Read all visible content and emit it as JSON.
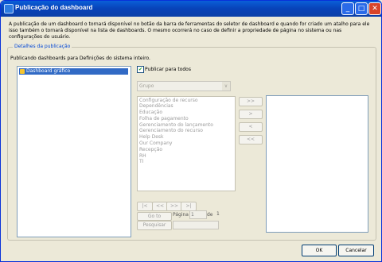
{
  "window": {
    "title": "Publicação do dashboard",
    "controls": {
      "minimize": "_",
      "maximize": "□",
      "close": "✕"
    }
  },
  "intro_text": "A publicação de um dashboard o tornará disponível no botão da barra de ferramentas do seletor de dashboard e quando for criado um atalho para ele isso também o tornará disponível na lista de dashboards. O mesmo ocorrerá no caso de definir a propriedade de página no sistema ou nas configurações do usuário.",
  "details": {
    "legend": "Detalhes da publicação",
    "publishing_text": "Publicando dashboards para Definições do sistema inteiro.",
    "tree_item": "Dashboard gráfico",
    "publish_all_label": "Publicar para todos",
    "publish_all_checked": true,
    "group_placeholder": "Grupo",
    "source_items": [
      "Configuração de recurso",
      "Dependências",
      "Educação",
      "Folha de pagamento",
      "Gerenciamento do lançamento",
      "Gerenciamento do recurso",
      "Help Desk",
      "Our Company",
      "Recepção",
      "RH",
      "TI"
    ],
    "move_buttons": [
      ">>",
      ">",
      "<",
      "<<"
    ],
    "pager": [
      "|<",
      "<<",
      ">>",
      ">|"
    ],
    "goto_label": "Go to",
    "page_label": "Página",
    "page_value": "1",
    "of_label": "de",
    "total_pages": "1",
    "search_label": "Pesquisar"
  },
  "buttons": {
    "ok": "OK",
    "cancel": "Cancelar"
  },
  "colors": {
    "titlebar": "#0842b8",
    "legend": "#0046d5",
    "selection": "#316ac5"
  }
}
